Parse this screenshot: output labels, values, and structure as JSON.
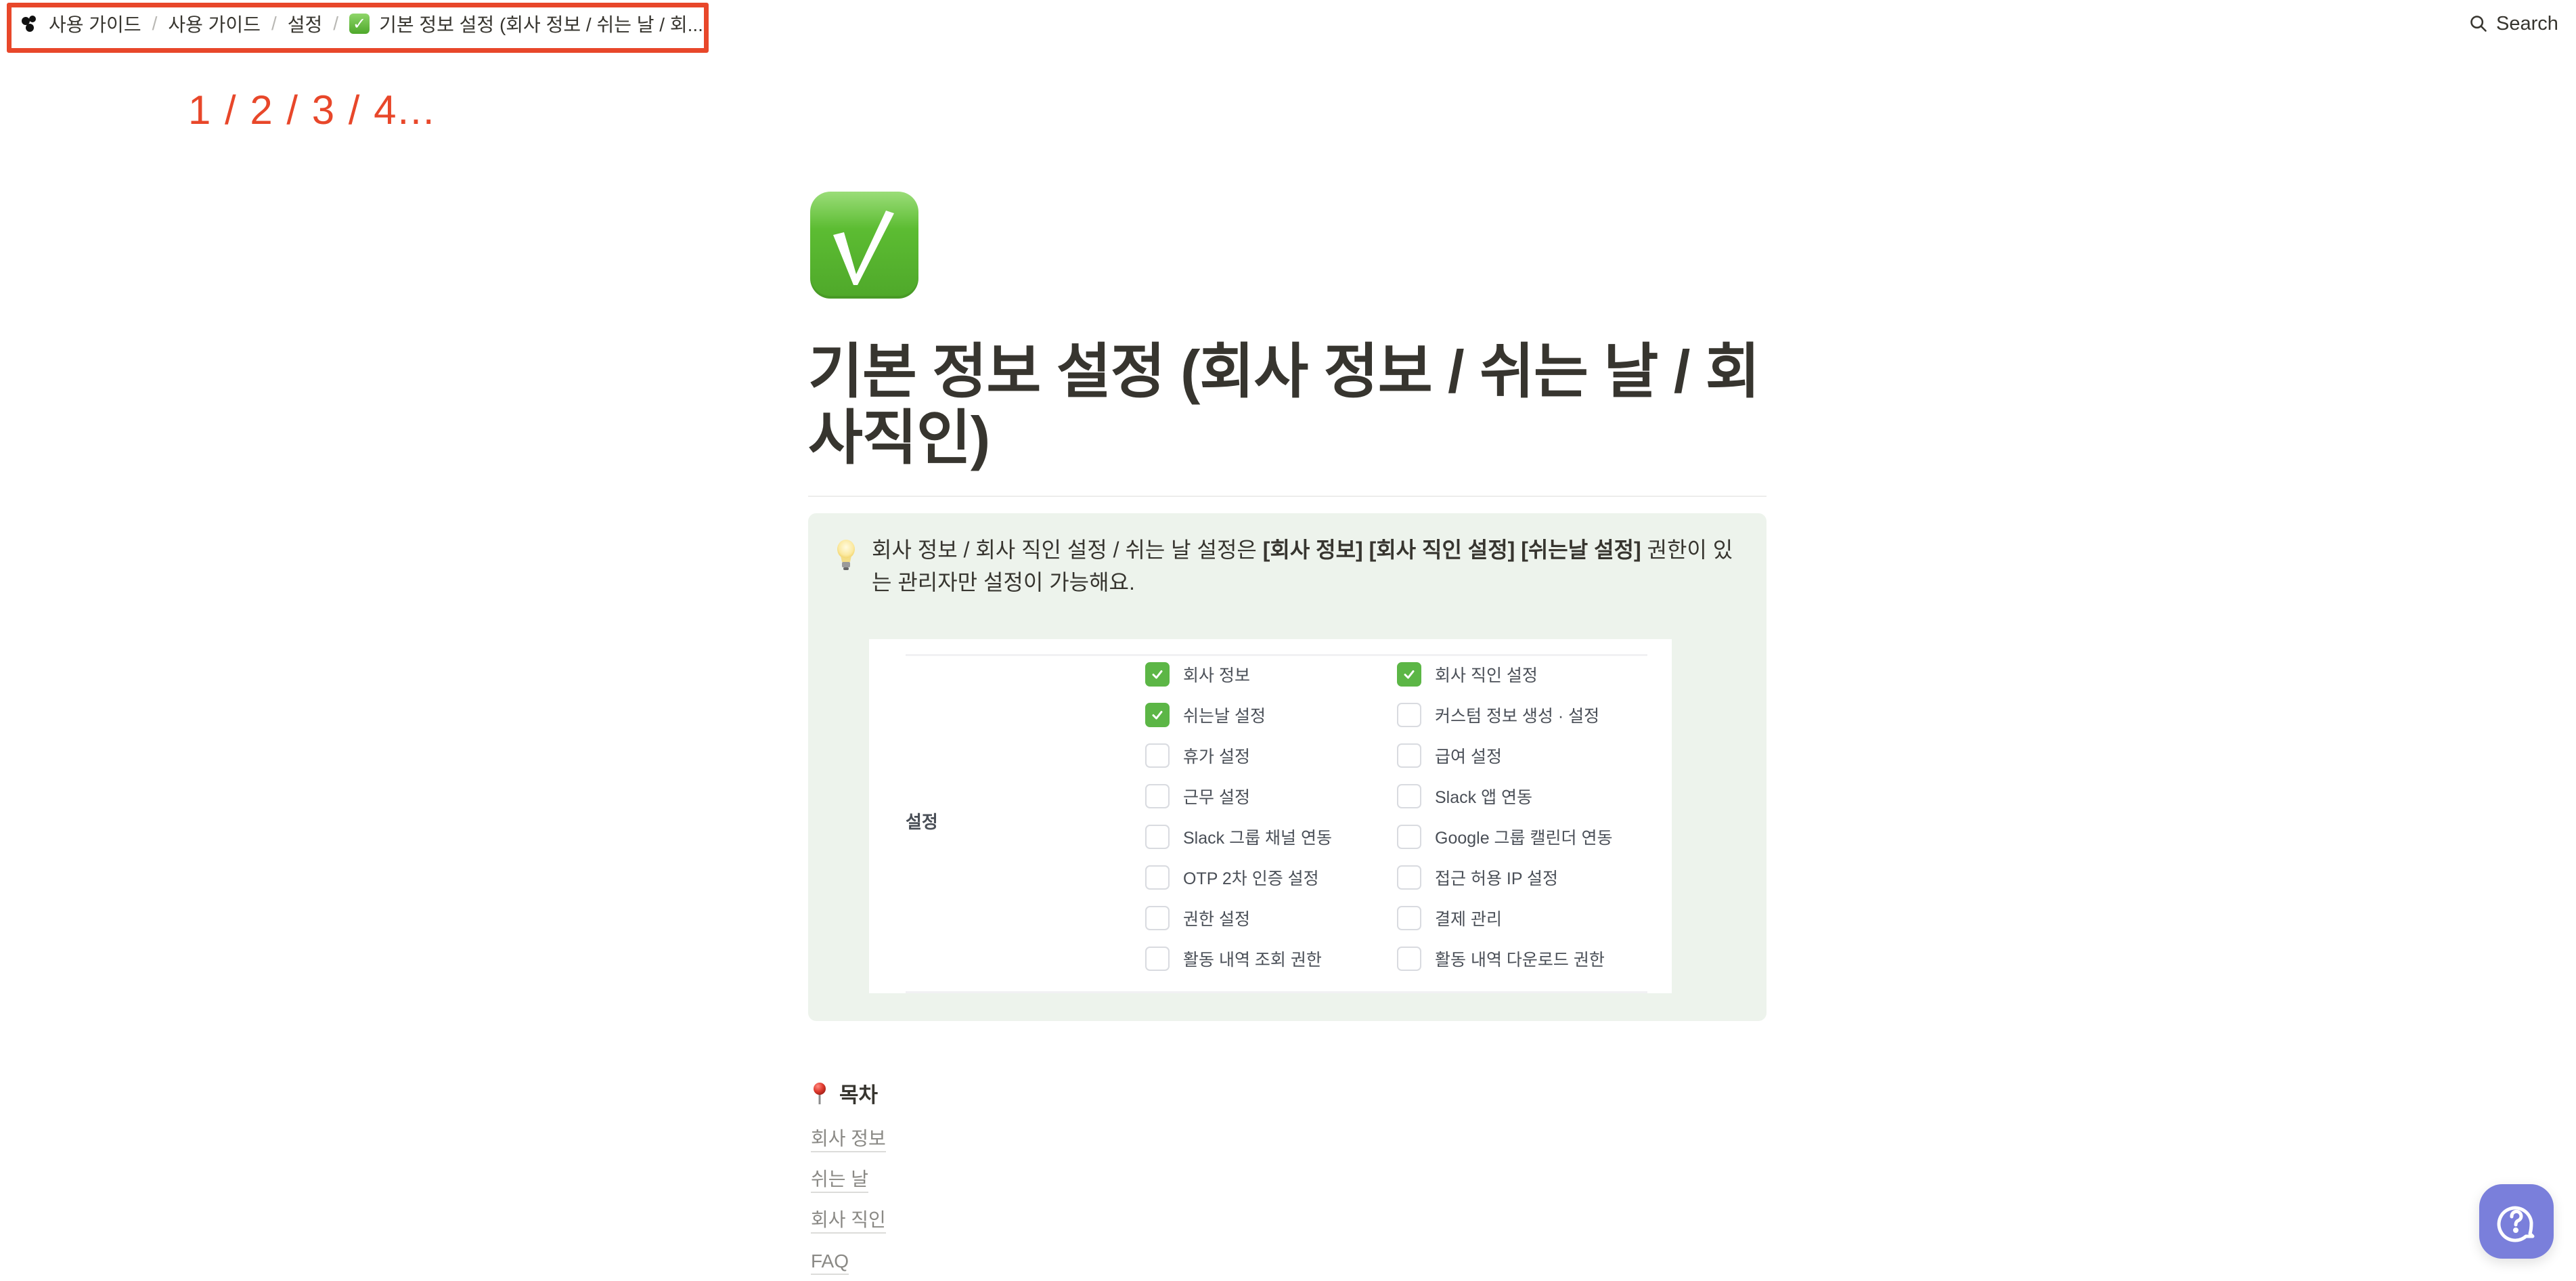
{
  "breadcrumb": {
    "items": [
      {
        "label": "사용 가이드",
        "icon": "workspace-logo-icon"
      },
      {
        "label": "사용 가이드"
      },
      {
        "label": "설정"
      },
      {
        "label": "기본 정보 설정 (회사 정보 / 쉬는 날 / 회...",
        "icon": "check-mark-emoji-icon"
      }
    ],
    "separator": "/"
  },
  "annotation": {
    "text": "1 / 2 / 3 / 4...",
    "color": "#e8472a"
  },
  "topbar": {
    "search_label": "Search"
  },
  "page": {
    "icon": "check-mark-emoji-icon",
    "title": "기본 정보 설정 (회사 정보 / 쉬는 날 / 회사직인)"
  },
  "callout": {
    "icon": "light-bulb-icon",
    "text_pre": "회사 정보 / 회사 직인 설정 / 쉬는 날 설정은 ",
    "text_bold": "[회사 정보] [회사 직인 설정] [쉬는날 설정]",
    "text_post": " 권한이 있는 관리자만 설정이 가능해요.",
    "background": "#edf3ec"
  },
  "permissions": {
    "section_label": "설정",
    "checked_color": "#5cb646",
    "left": [
      {
        "label": "회사 정보",
        "checked": true
      },
      {
        "label": "쉬는날 설정",
        "checked": true
      },
      {
        "label": "휴가 설정",
        "checked": false
      },
      {
        "label": "근무 설정",
        "checked": false
      },
      {
        "label": "Slack 그룹 채널 연동",
        "checked": false
      },
      {
        "label": "OTP 2차 인증 설정",
        "checked": false
      },
      {
        "label": "권한 설정",
        "checked": false
      },
      {
        "label": "활동 내역 조회 권한",
        "checked": false
      }
    ],
    "right": [
      {
        "label": "회사 직인 설정",
        "checked": true
      },
      {
        "label": "커스텀 정보 생성 · 설정",
        "checked": false
      },
      {
        "label": "급여 설정",
        "checked": false
      },
      {
        "label": "Slack 앱 연동",
        "checked": false
      },
      {
        "label": "Google 그룹 캘린더 연동",
        "checked": false
      },
      {
        "label": "접근 허용 IP 설정",
        "checked": false
      },
      {
        "label": "결제 관리",
        "checked": false
      },
      {
        "label": "활동 내역 다운로드 권한",
        "checked": false
      }
    ]
  },
  "toc": {
    "icon": "round-pushpin-icon",
    "heading": "목차",
    "links": [
      "회사 정보",
      "쉬는 날",
      "회사 직인",
      "FAQ"
    ]
  },
  "help_button": {
    "icon": "help-chat-icon",
    "color": "#7a7fdb"
  }
}
